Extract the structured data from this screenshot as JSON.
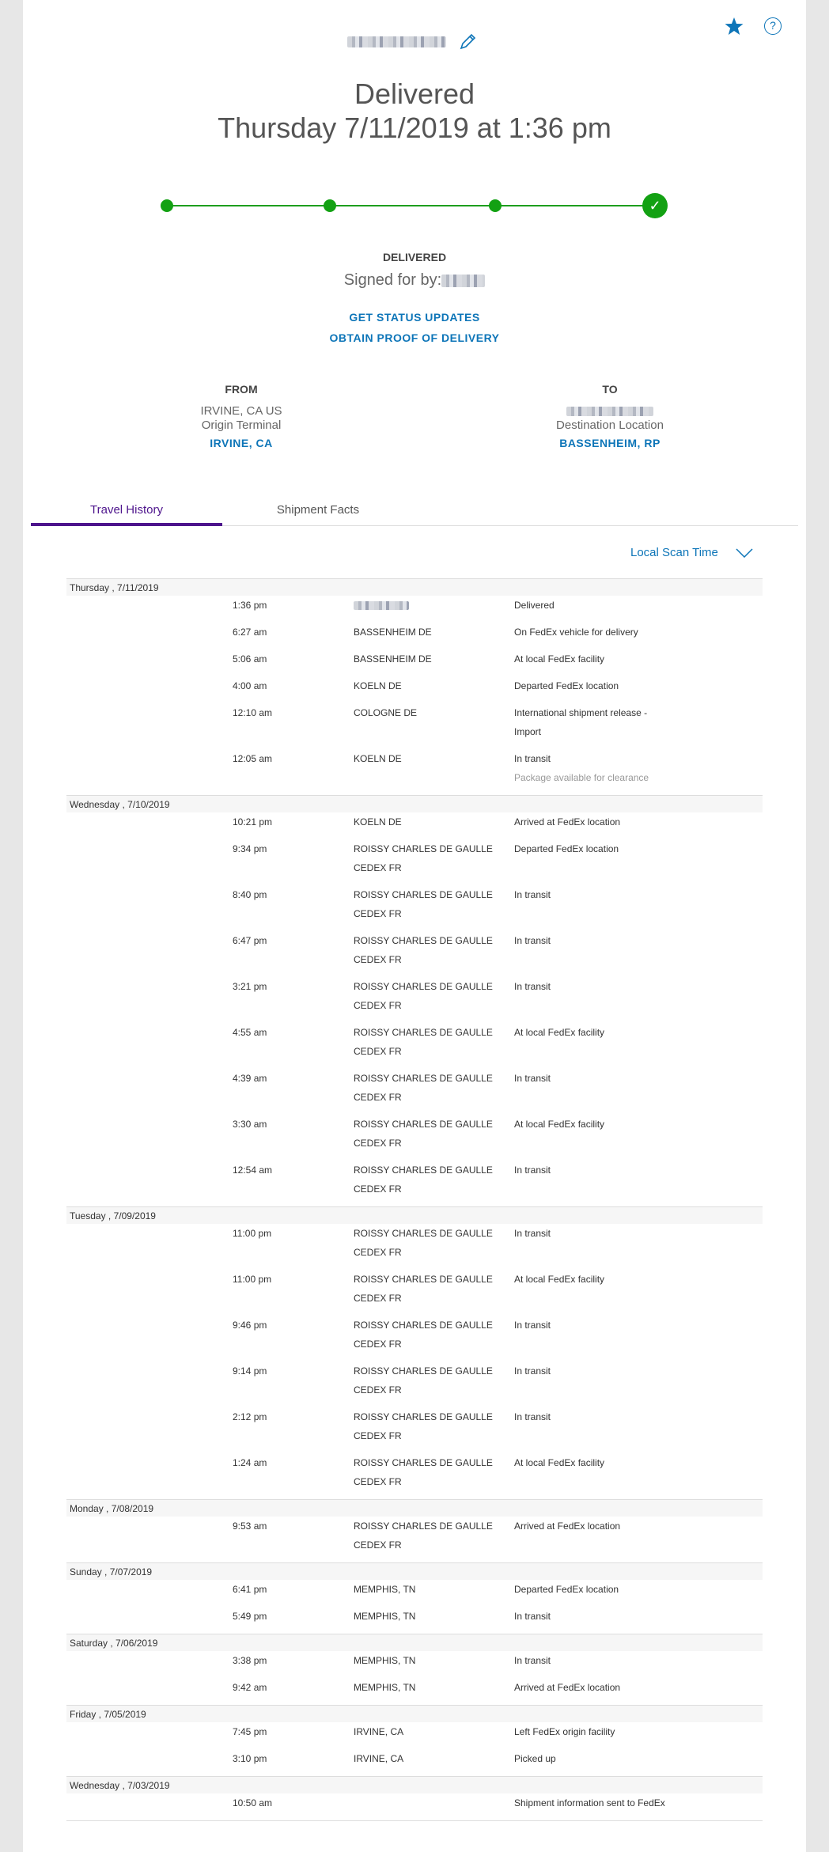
{
  "header": {
    "status": "Delivered",
    "datetime": "Thursday 7/11/2019 at 1:36 pm",
    "delivered_label": "DELIVERED",
    "signed_for_label": "Signed for by:",
    "get_updates": "GET STATUS UPDATES",
    "proof": "OBTAIN PROOF OF DELIVERY"
  },
  "colors": {
    "accent": "#0d75b8",
    "progress": "#13a113",
    "tab_active": "#4d148c"
  },
  "from": {
    "head": "FROM",
    "line1": "IRVINE, CA US",
    "line2": "Origin Terminal",
    "city": "IRVINE, CA"
  },
  "to": {
    "head": "TO",
    "line2": "Destination Location",
    "city": "BASSENHEIM, RP"
  },
  "tabs": [
    {
      "label": "Travel History"
    },
    {
      "label": "Shipment Facts"
    }
  ],
  "scan_time_label": "Local Scan Time",
  "history": [
    {
      "date": "Thursday , 7/11/2019",
      "events": [
        {
          "time": "1:36 pm",
          "loc": "",
          "loc_blur": true,
          "desc": "Delivered"
        },
        {
          "time": "6:27 am",
          "loc": "BASSENHEIM DE",
          "desc": "On FedEx vehicle for delivery"
        },
        {
          "time": "5:06 am",
          "loc": "BASSENHEIM DE",
          "desc": "At local FedEx facility"
        },
        {
          "time": "4:00 am",
          "loc": "KOELN DE",
          "desc": "Departed FedEx location"
        },
        {
          "time": "12:10 am",
          "loc": "COLOGNE DE",
          "desc": "International shipment release - Import",
          "wrap": true
        },
        {
          "time": "12:05 am",
          "loc": "KOELN DE",
          "desc": "In transit",
          "sub": "Package available for clearance"
        }
      ]
    },
    {
      "date": "Wednesday , 7/10/2019",
      "events": [
        {
          "time": "10:21 pm",
          "loc": "KOELN DE",
          "desc": "Arrived at FedEx location"
        },
        {
          "time": "9:34 pm",
          "loc": "ROISSY CHARLES DE GAULLE CEDEX FR",
          "desc": "Departed FedEx location",
          "wrap": true
        },
        {
          "time": "8:40 pm",
          "loc": "ROISSY CHARLES DE GAULLE CEDEX FR",
          "desc": "In transit",
          "wrap": true
        },
        {
          "time": "6:47 pm",
          "loc": "ROISSY CHARLES DE GAULLE CEDEX FR",
          "desc": "In transit",
          "wrap": true
        },
        {
          "time": "3:21 pm",
          "loc": "ROISSY CHARLES DE GAULLE CEDEX FR",
          "desc": "In transit",
          "wrap": true
        },
        {
          "time": "4:55 am",
          "loc": "ROISSY CHARLES DE GAULLE CEDEX FR",
          "desc": "At local FedEx facility",
          "wrap": true
        },
        {
          "time": "4:39 am",
          "loc": "ROISSY CHARLES DE GAULLE CEDEX FR",
          "desc": "In transit",
          "wrap": true
        },
        {
          "time": "3:30 am",
          "loc": "ROISSY CHARLES DE GAULLE CEDEX FR",
          "desc": "At local FedEx facility",
          "wrap": true
        },
        {
          "time": "12:54 am",
          "loc": "ROISSY CHARLES DE GAULLE CEDEX FR",
          "desc": "In transit",
          "wrap": true
        }
      ]
    },
    {
      "date": "Tuesday , 7/09/2019",
      "events": [
        {
          "time": "11:00 pm",
          "loc": "ROISSY CHARLES DE GAULLE CEDEX FR",
          "desc": "In transit",
          "wrap": true
        },
        {
          "time": "11:00 pm",
          "loc": "ROISSY CHARLES DE GAULLE CEDEX FR",
          "desc": "At local FedEx facility",
          "wrap": true
        },
        {
          "time": "9:46 pm",
          "loc": "ROISSY CHARLES DE GAULLE CEDEX FR",
          "desc": "In transit",
          "wrap": true
        },
        {
          "time": "9:14 pm",
          "loc": "ROISSY CHARLES DE GAULLE CEDEX FR",
          "desc": "In transit",
          "wrap": true
        },
        {
          "time": "2:12 pm",
          "loc": "ROISSY CHARLES DE GAULLE CEDEX FR",
          "desc": "In transit",
          "wrap": true
        },
        {
          "time": "1:24 am",
          "loc": "ROISSY CHARLES DE GAULLE CEDEX FR",
          "desc": "At local FedEx facility",
          "wrap": true
        }
      ]
    },
    {
      "date": "Monday , 7/08/2019",
      "events": [
        {
          "time": "9:53 am",
          "loc": "ROISSY CHARLES DE GAULLE CEDEX FR",
          "desc": "Arrived at FedEx location",
          "wrap": true
        }
      ]
    },
    {
      "date": "Sunday , 7/07/2019",
      "events": [
        {
          "time": "6:41 pm",
          "loc": "MEMPHIS, TN",
          "desc": "Departed FedEx location"
        },
        {
          "time": "5:49 pm",
          "loc": "MEMPHIS, TN",
          "desc": "In transit"
        }
      ]
    },
    {
      "date": "Saturday , 7/06/2019",
      "events": [
        {
          "time": "3:38 pm",
          "loc": "MEMPHIS, TN",
          "desc": "In transit"
        },
        {
          "time": "9:42 am",
          "loc": "MEMPHIS, TN",
          "desc": "Arrived at FedEx location"
        }
      ]
    },
    {
      "date": "Friday , 7/05/2019",
      "events": [
        {
          "time": "7:45 pm",
          "loc": "IRVINE, CA",
          "desc": "Left FedEx origin facility"
        },
        {
          "time": "3:10 pm",
          "loc": "IRVINE, CA",
          "desc": "Picked up"
        }
      ]
    },
    {
      "date": "Wednesday , 7/03/2019",
      "events": [
        {
          "time": "10:50 am",
          "loc": "",
          "desc": "Shipment information sent to FedEx"
        }
      ]
    }
  ]
}
